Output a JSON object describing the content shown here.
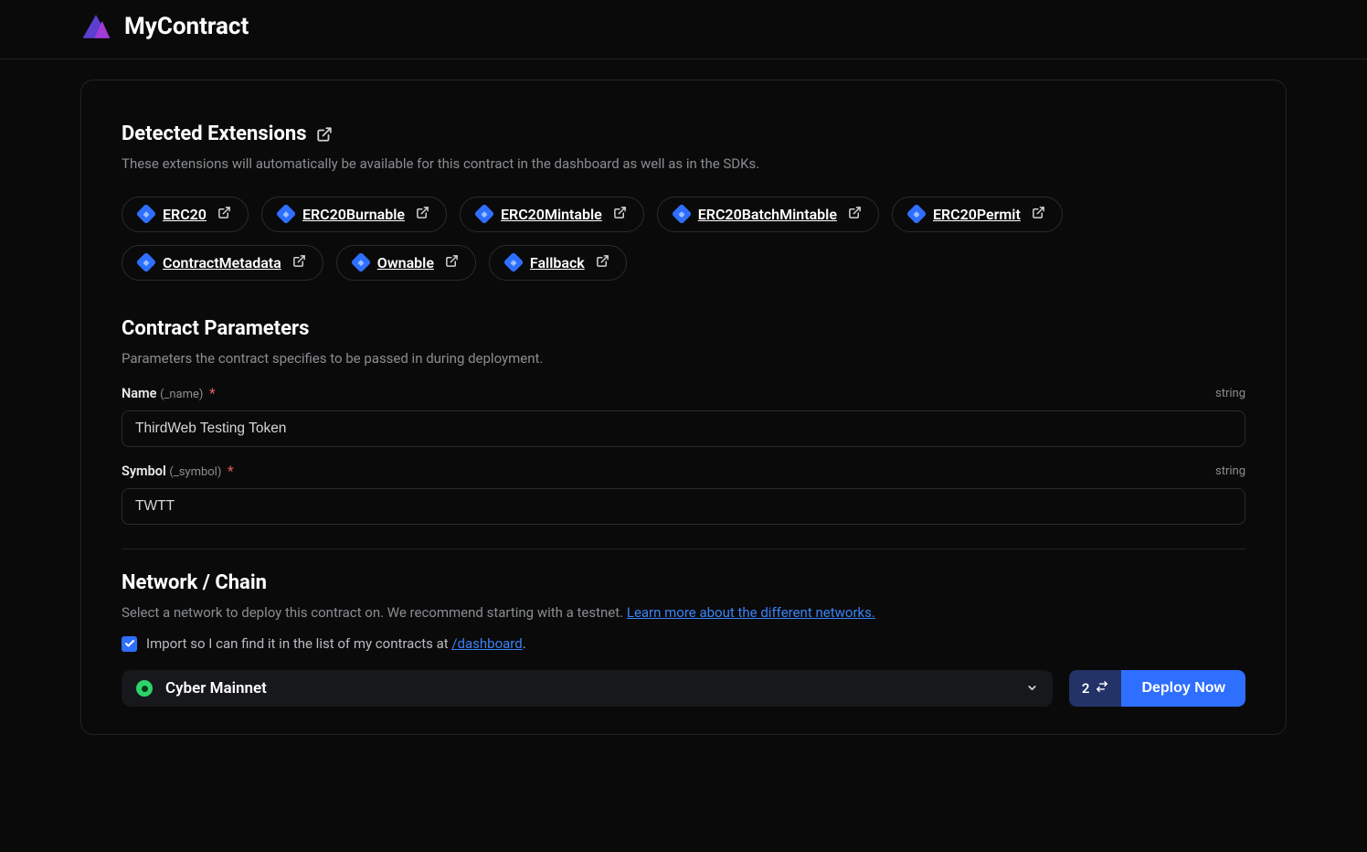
{
  "header": {
    "contract_name": "MyContract"
  },
  "extensions": {
    "title": "Detected Extensions",
    "description": "These extensions will automatically be available for this contract in the dashboard as well as in the SDKs.",
    "items": [
      {
        "label": "ERC20"
      },
      {
        "label": "ERC20Burnable"
      },
      {
        "label": "ERC20Mintable"
      },
      {
        "label": "ERC20BatchMintable"
      },
      {
        "label": "ERC20Permit"
      },
      {
        "label": "ContractMetadata"
      },
      {
        "label": "Ownable"
      },
      {
        "label": "Fallback"
      }
    ]
  },
  "params": {
    "title": "Contract Parameters",
    "description": "Parameters the contract specifies to be passed in during deployment.",
    "fields": {
      "name": {
        "label": "Name",
        "param": "(_name)",
        "required_mark": "*",
        "type": "string",
        "value": "ThirdWeb Testing Token"
      },
      "symbol": {
        "label": "Symbol",
        "param": "(_symbol)",
        "required_mark": "*",
        "type": "string",
        "value": "TWTT"
      }
    }
  },
  "network": {
    "title": "Network / Chain",
    "description_prefix": "Select a network to deploy this contract on. We recommend starting with a testnet. ",
    "learn_more": "Learn more about the different networks.",
    "import_checkbox": {
      "checked": true,
      "label_prefix": "Import so I can find it in the list of my contracts at ",
      "link_text": "/dashboard",
      "label_suffix": "."
    },
    "selected": "Cyber Mainnet"
  },
  "deploy": {
    "step_count": "2",
    "button_label": "Deploy Now"
  }
}
